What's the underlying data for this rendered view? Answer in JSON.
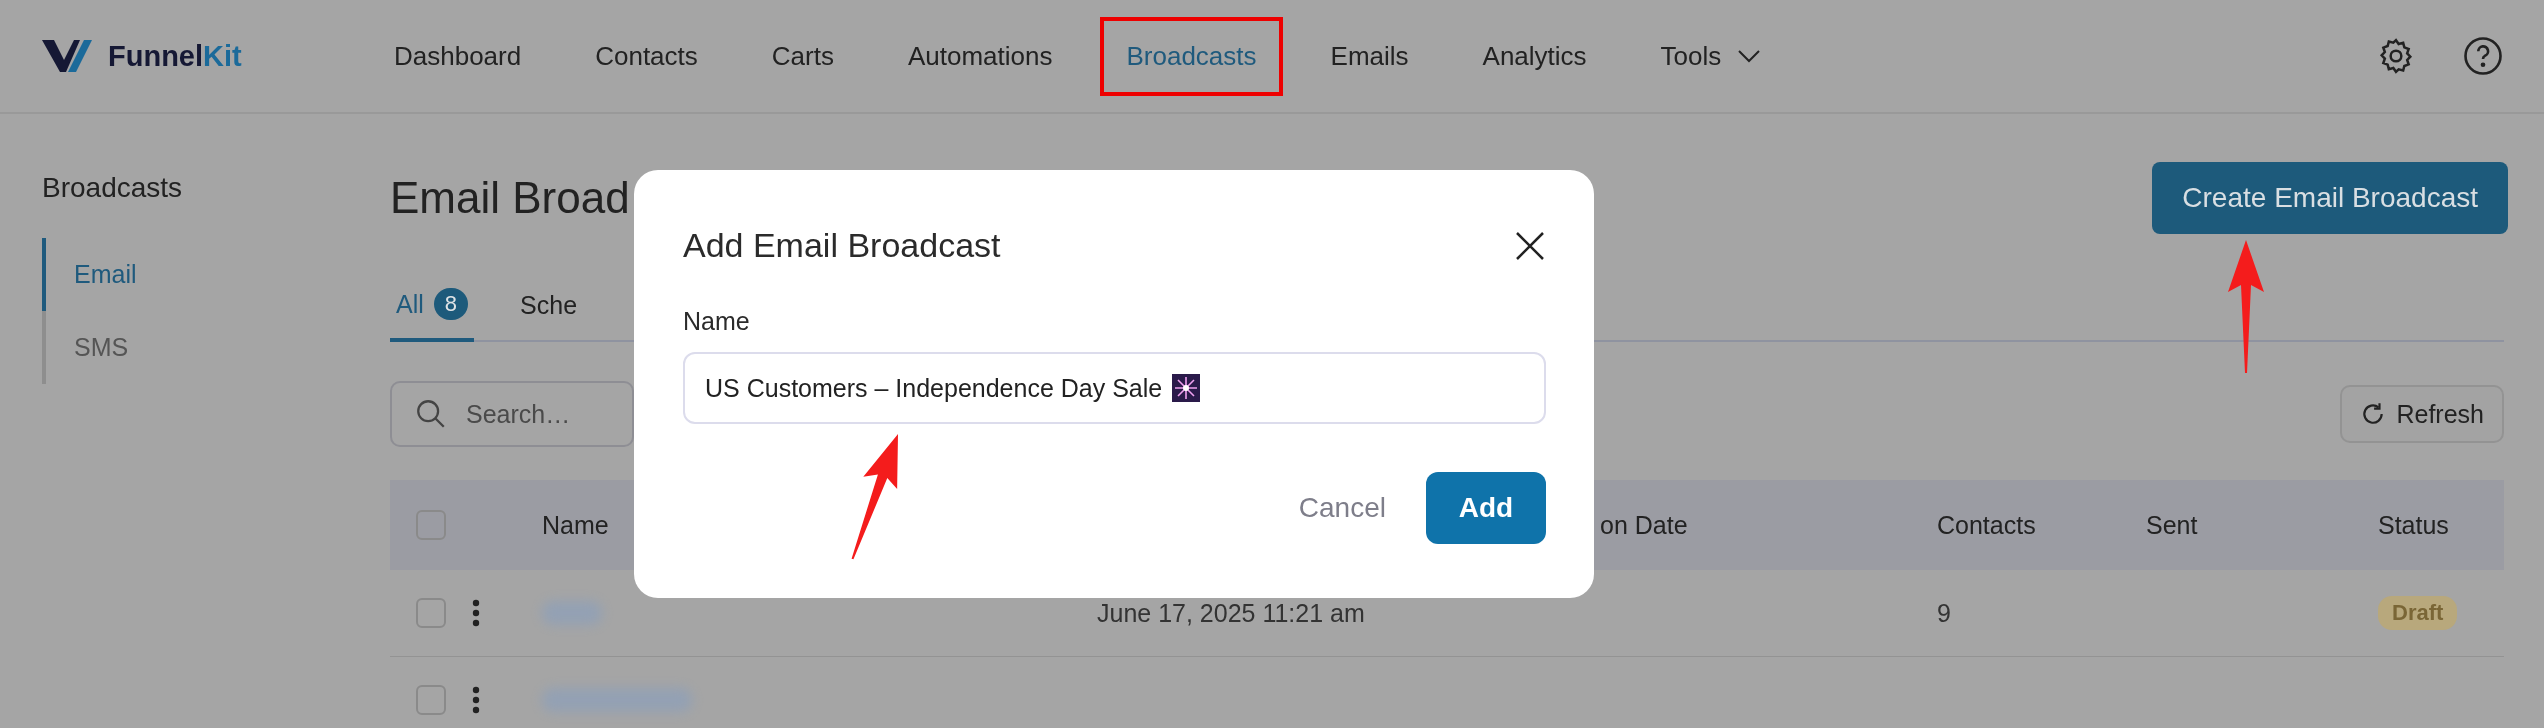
{
  "logo": {
    "text": "Funnel",
    "accent": "Kit"
  },
  "nav": [
    {
      "label": "Dashboard",
      "selected": false,
      "highlighted": false
    },
    {
      "label": "Contacts",
      "selected": false,
      "highlighted": false
    },
    {
      "label": "Carts",
      "selected": false,
      "highlighted": false
    },
    {
      "label": "Automations",
      "selected": false,
      "highlighted": false
    },
    {
      "label": "Broadcasts",
      "selected": true,
      "highlighted": true
    },
    {
      "label": "Emails",
      "selected": false,
      "highlighted": false
    },
    {
      "label": "Analytics",
      "selected": false,
      "highlighted": false
    },
    {
      "label": "Tools",
      "selected": false,
      "highlighted": false,
      "kind": "dropdown"
    }
  ],
  "sidebar": {
    "title": "Broadcasts",
    "items": [
      {
        "label": "Email",
        "selected": true
      },
      {
        "label": "SMS",
        "selected": false
      }
    ]
  },
  "page": {
    "title": "Email Broad",
    "create_button": "Create Email Broadcast"
  },
  "tabs": [
    {
      "label": "All",
      "count": "8",
      "selected": true
    },
    {
      "label": "Sche",
      "selected": false
    }
  ],
  "search": {
    "placeholder": "Search…"
  },
  "refresh_button": "Refresh",
  "table": {
    "header_checked": false,
    "columns": [
      "Name",
      "",
      "on Date",
      "Contacts",
      "Sent",
      "Status"
    ],
    "rows": [
      {
        "checked": false,
        "date": "June 17, 2025 11:21 am",
        "contacts": "9",
        "status": "Draft"
      },
      {
        "checked": false
      }
    ]
  },
  "modal": {
    "title": "Add Email Broadcast",
    "field_label": "Name",
    "field_value": "US Customers – Independence Day Sale",
    "cancel": "Cancel",
    "submit": "Add"
  }
}
